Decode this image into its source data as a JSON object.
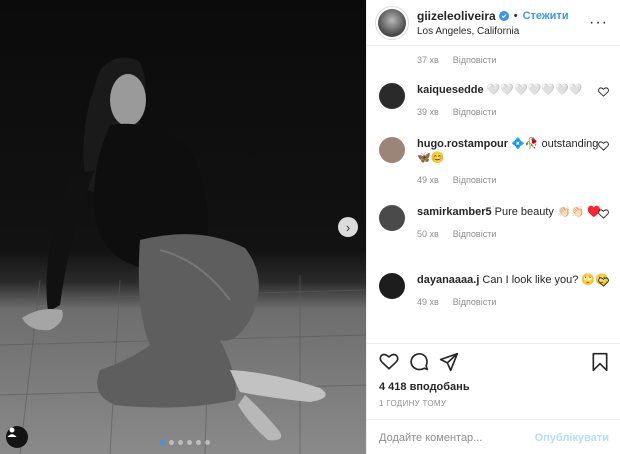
{
  "post": {
    "dots_total": 6,
    "active_dot": 1,
    "next_icon": "chevron-right-icon",
    "user_tag_icon": "person-icon"
  },
  "header": {
    "username": "giizeleoliveira",
    "separator": "•",
    "follow_label": "Стежити",
    "location": "Los Angeles, California",
    "more_label": "···"
  },
  "first_meta": {
    "time": "37 хв",
    "reply": "Відповісти"
  },
  "comments": [
    {
      "user": "kaiquesedde",
      "text": "🤍🤍🤍🤍🤍🤍🤍",
      "time": "39 хв",
      "reply": "Відповісти",
      "avatar_color": "#2a2a2a"
    },
    {
      "user": "hugo.rostampour",
      "text": "💠🥀 outstanding 🦋😊",
      "time": "49 хв",
      "reply": "Відповісти",
      "avatar_color": "#9a8578"
    },
    {
      "user": "samirkamber5",
      "text": "Pure beauty 👏🏻👏🏻 ♥️",
      "time": "50 хв",
      "reply": "Відповісти",
      "avatar_color": "#4a4a4a"
    },
    {
      "user": "dayanaaaa.j",
      "text": "Can I look like you? 🙄🙄",
      "time": "49 хв",
      "reply": "Відповісти",
      "avatar_color": "#1d1d1d"
    }
  ],
  "actions": {
    "likes": "4 418 вподобань",
    "time": "1 ГОДИНУ ТОМУ",
    "comment_placeholder": "Додайте коментар...",
    "publish_label": "Опублікувати"
  },
  "colors": {
    "accent": "#3897f0",
    "muted": "#8e8e8e",
    "text": "#262626",
    "publish_disabled": "#b2dffc"
  }
}
